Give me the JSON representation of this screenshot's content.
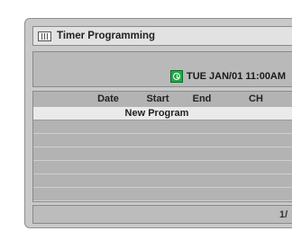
{
  "window": {
    "title": "Timer Programming"
  },
  "status": {
    "datetime": "TUE JAN/01 11:00AM",
    "clock_icon": "green-clock-icon"
  },
  "table": {
    "columns": [
      "Date",
      "Start",
      "End",
      "CH"
    ],
    "rows": [
      "New Program",
      "",
      "",
      "",
      "",
      "",
      ""
    ]
  },
  "footer": {
    "page": "1/"
  },
  "colors": {
    "window": "#c9c9c9",
    "selected_row": "#eaeaea",
    "clock": "#23a84a"
  }
}
